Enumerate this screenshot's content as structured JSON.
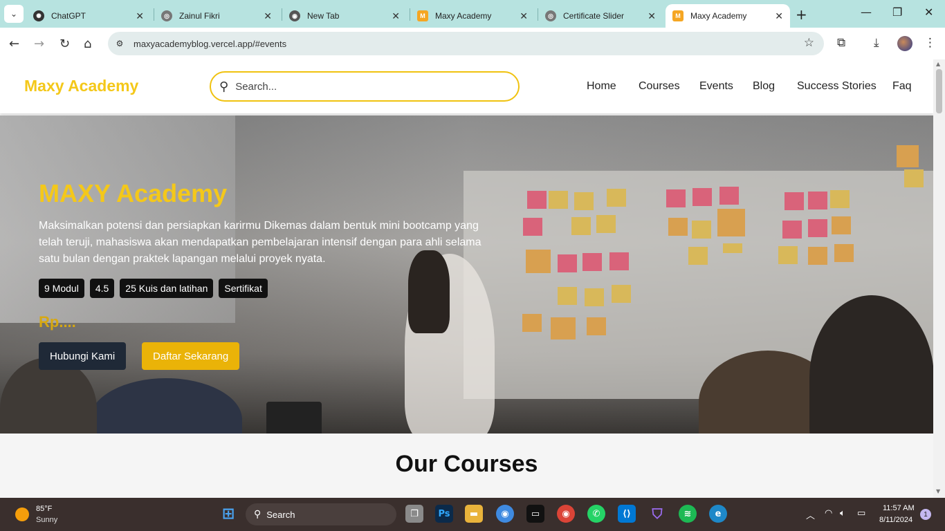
{
  "browser": {
    "tabs": [
      {
        "title": "ChatGPT",
        "icon": "chatgpt-icon",
        "active": false
      },
      {
        "title": "Zainul Fikri",
        "icon": "globe-icon",
        "active": false
      },
      {
        "title": "New Tab",
        "icon": "chrome-icon",
        "active": false
      },
      {
        "title": "Maxy Academy",
        "icon": "maxy-icon",
        "active": false
      },
      {
        "title": "Certificate Slider",
        "icon": "globe-icon",
        "active": false
      },
      {
        "title": "Maxy Academy",
        "icon": "maxy-icon",
        "active": true
      }
    ],
    "url": "maxyacademyblog.vercel.app/#events"
  },
  "site": {
    "logo": "Maxy Academy",
    "search_placeholder": "Search...",
    "nav": [
      "Home",
      "Courses",
      "Events",
      "Blog",
      "Success Stories",
      "Faq"
    ]
  },
  "hero": {
    "title": "MAXY Academy",
    "description": "Maksimalkan potensi dan persiapkan karirmu Dikemas dalam bentuk mini bootcamp yang telah teruji, mahasiswa akan mendapatkan pembelajaran intensif dengan para ahli selama satu bulan dengan praktek lapangan melalui proyek nyata.",
    "badges": [
      "9 Modul",
      "4.5",
      "25 Kuis dan latihan",
      "Sertifikat"
    ],
    "price": "Rp....",
    "buttons": {
      "contact": "Hubungi Kami",
      "register": "Daftar Sekarang"
    }
  },
  "courses": {
    "title": "Our Courses"
  },
  "taskbar": {
    "weather_temp": "85°F",
    "weather_condition": "Sunny",
    "search_label": "Search",
    "time": "11:57 AM",
    "date": "8/11/2024",
    "notifications": "1"
  },
  "colors": {
    "brand": "#f4c81a",
    "accent_button": "#eab308",
    "dark_button": "#1f2937"
  }
}
